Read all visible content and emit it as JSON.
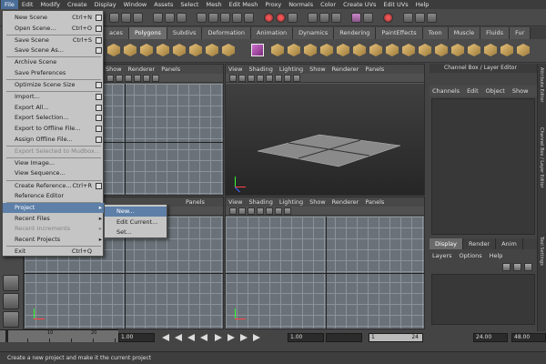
{
  "menubar": [
    "File",
    "Edit",
    "Modify",
    "Create",
    "Display",
    "Window",
    "Assets",
    "Select",
    "Mesh",
    "Edit Mesh",
    "Proxy",
    "Normals",
    "Color",
    "Create UVs",
    "Edit UVs",
    "Help"
  ],
  "shelf_tabs": [
    "aces",
    "Polygons",
    "Subdivs",
    "Deformation",
    "Animation",
    "Dynamics",
    "Rendering",
    "PaintEffects",
    "Toon",
    "Muscle",
    "Fluids",
    "Fur"
  ],
  "viewport_menu": [
    "View",
    "Shading",
    "Lighting",
    "Show",
    "Renderer",
    "Panels"
  ],
  "viewport_menu_left": [
    "Show",
    "Renderer",
    "Panels"
  ],
  "viewport_bl_menu": [
    "Panels"
  ],
  "channel_box": {
    "title": "Channel Box / Layer Editor",
    "menu": [
      "Channels",
      "Edit",
      "Object",
      "Show"
    ]
  },
  "layer_editor": {
    "tabs": [
      "Display",
      "Render",
      "Anim"
    ],
    "menu": [
      "Layers",
      "Options",
      "Help"
    ]
  },
  "side_strip": [
    "Attribute Editor",
    "Channel Box / Layer Editor",
    "Tool Settings"
  ],
  "file_menu": {
    "items": [
      {
        "label": "New Scene",
        "shortcut": "Ctrl+N",
        "option": true
      },
      {
        "label": "Open Scene...",
        "shortcut": "Ctrl+O",
        "option": true
      },
      {
        "label": "Save Scene",
        "shortcut": "Ctrl+S",
        "option": true
      },
      {
        "label": "Save Scene As...",
        "shortcut": "",
        "option": true
      },
      {
        "label": "Archive Scene",
        "shortcut": "",
        "option": false
      },
      {
        "label": "Save Preferences",
        "shortcut": "",
        "option": false
      },
      {
        "label": "Optimize Scene Size",
        "shortcut": "",
        "option": true
      },
      {
        "label": "Import...",
        "shortcut": "",
        "option": true
      },
      {
        "label": "Export All...",
        "shortcut": "",
        "option": true
      },
      {
        "label": "Export Selection...",
        "shortcut": "",
        "option": true
      },
      {
        "label": "Export to Offline File...",
        "shortcut": "",
        "option": true
      },
      {
        "label": "Assign Offline File...",
        "shortcut": "",
        "option": true
      },
      {
        "label": "Export Selected to Mudbox...",
        "shortcut": "",
        "option": false,
        "disabled": true
      },
      {
        "label": "View Image...",
        "shortcut": "",
        "option": false
      },
      {
        "label": "View Sequence...",
        "shortcut": "",
        "option": false
      },
      {
        "label": "Create Reference...",
        "shortcut": "Ctrl+R",
        "option": true
      },
      {
        "label": "Reference Editor",
        "shortcut": "",
        "option": false
      },
      {
        "label": "Project",
        "shortcut": "",
        "arrow": true,
        "highlight": true
      },
      {
        "label": "Recent Files",
        "shortcut": "",
        "arrow": true
      },
      {
        "label": "Recent Increments",
        "shortcut": "",
        "arrow": true,
        "disabled": true
      },
      {
        "label": "Recent Projects",
        "shortcut": "",
        "arrow": true
      },
      {
        "label": "Exit",
        "shortcut": "Ctrl+Q",
        "option": false
      }
    ]
  },
  "project_submenu": [
    "New...",
    "Edit Current...",
    "Set..."
  ],
  "time_slider": {
    "labels": [
      "10",
      "20"
    ]
  },
  "range": {
    "start": "1.00",
    "playback_start": "1.00",
    "range_start": "1",
    "range_end": "24",
    "playback_end": "24.00",
    "end": "48.00"
  },
  "help_line": "Create a new project and make it the current project"
}
